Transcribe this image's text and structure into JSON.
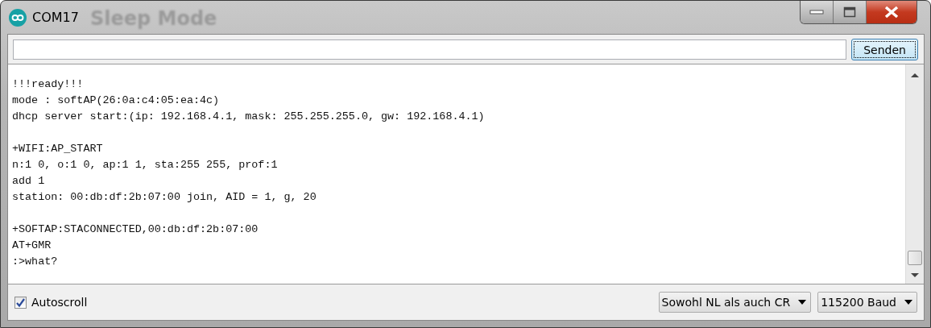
{
  "window": {
    "title": "COM17",
    "background_window_title": "Sleep Mode"
  },
  "send_button": {
    "label": "Senden"
  },
  "output_blocks": [
    [
      "!!!ready!!!",
      "mode : softAP(26:0a:c4:05:ea:4c)",
      "dhcp server start:(ip: 192.168.4.1, mask: 255.255.255.0, gw: 192.168.4.1)"
    ],
    [
      "+WIFI:AP_START",
      "n:1 0, o:1 0, ap:1 1, sta:255 255, prof:1",
      "add 1",
      "station: 00:db:df:2b:07:00 join, AID = 1, g, 20"
    ],
    [
      "+SOFTAP:STACONNECTED,00:db:df:2b:07:00",
      "AT+GMR",
      ":>what?"
    ]
  ],
  "autoscroll": {
    "label": "Autoscroll",
    "checked": true
  },
  "line_ending": {
    "value": "Sowohl NL als auch CR"
  },
  "baud_rate": {
    "value": "115200 Baud"
  }
}
